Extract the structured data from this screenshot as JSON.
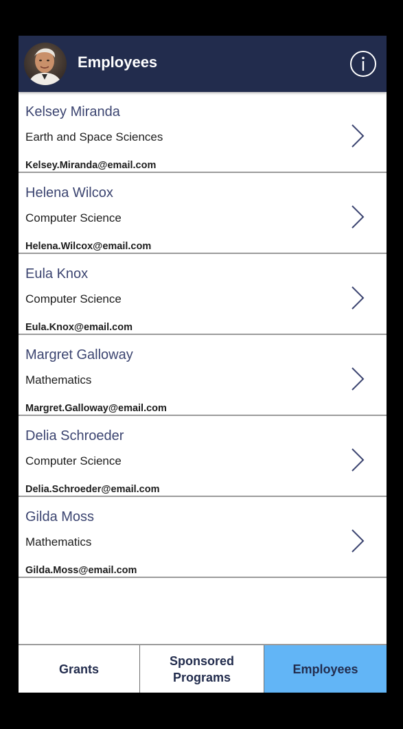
{
  "header": {
    "title": "Employees",
    "avatar_icon": "user-avatar-photo",
    "info_icon": "info-circle-icon",
    "background_color": "#222c4d"
  },
  "employees": [
    {
      "name": "Kelsey Miranda",
      "department": "Earth and Space Sciences",
      "email": "Kelsey.Miranda@email.com"
    },
    {
      "name": "Helena Wilcox",
      "department": "Computer Science",
      "email": "Helena.Wilcox@email.com"
    },
    {
      "name": "Eula Knox",
      "department": "Computer Science",
      "email": "Eula.Knox@email.com"
    },
    {
      "name": "Margret Galloway",
      "department": "Mathematics",
      "email": "Margret.Galloway@email.com"
    },
    {
      "name": "Delia Schroeder",
      "department": "Computer Science",
      "email": "Delia.Schroeder@email.com"
    },
    {
      "name": "Gilda Moss",
      "department": "Mathematics",
      "email": "Gilda.Moss@email.com"
    }
  ],
  "row_icon": "chevron-right-icon",
  "tabs": [
    {
      "label": "Grants",
      "selected": false
    },
    {
      "label": "Sponsored\nPrograms",
      "selected": false
    },
    {
      "label": "Employees",
      "selected": true
    }
  ],
  "colors": {
    "accent": "#62b5f6",
    "name_text": "#3b4470",
    "divider": "#9a9a9a"
  }
}
